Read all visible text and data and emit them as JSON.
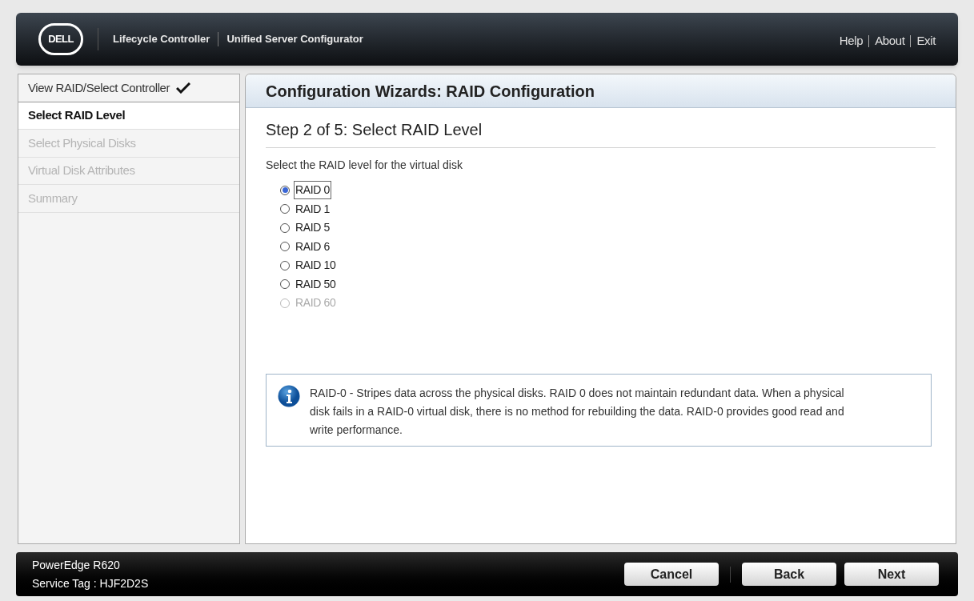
{
  "header": {
    "logo": "DELL",
    "titles": [
      "Lifecycle Controller",
      "Unified Server Configurator"
    ],
    "links": [
      "Help",
      "About",
      "Exit"
    ]
  },
  "sidebar": {
    "items": [
      {
        "label": "View RAID/Select Controller",
        "completed": true,
        "selected": false,
        "disabled": false
      },
      {
        "label": "Select RAID Level",
        "completed": false,
        "selected": true,
        "disabled": false
      },
      {
        "label": "Select Physical Disks",
        "completed": false,
        "selected": false,
        "disabled": true
      },
      {
        "label": "Virtual Disk Attributes",
        "completed": false,
        "selected": false,
        "disabled": true
      },
      {
        "label": "Summary",
        "completed": false,
        "selected": false,
        "disabled": true
      }
    ]
  },
  "main": {
    "title": "Configuration Wizards: RAID Configuration",
    "step": "Step 2 of 5: Select RAID Level",
    "prompt": "Select the RAID level for the virtual disk",
    "options": [
      {
        "label": "RAID 0",
        "selected": true,
        "disabled": false
      },
      {
        "label": "RAID 1",
        "selected": false,
        "disabled": false
      },
      {
        "label": "RAID 5",
        "selected": false,
        "disabled": false
      },
      {
        "label": "RAID 6",
        "selected": false,
        "disabled": false
      },
      {
        "label": "RAID 10",
        "selected": false,
        "disabled": false
      },
      {
        "label": "RAID 50",
        "selected": false,
        "disabled": false
      },
      {
        "label": "RAID 60",
        "selected": false,
        "disabled": true
      }
    ],
    "info": "RAID-0 - Stripes data across the physical disks. RAID 0 does not maintain redundant data. When a physical disk fails in a RAID-0 virtual disk, there is no method for rebuilding the data. RAID-0 provides good read and write performance."
  },
  "footer": {
    "model": "PowerEdge R620",
    "service_tag": "Service Tag : HJF2D2S",
    "buttons": [
      "Cancel",
      "Back",
      "Next"
    ]
  }
}
